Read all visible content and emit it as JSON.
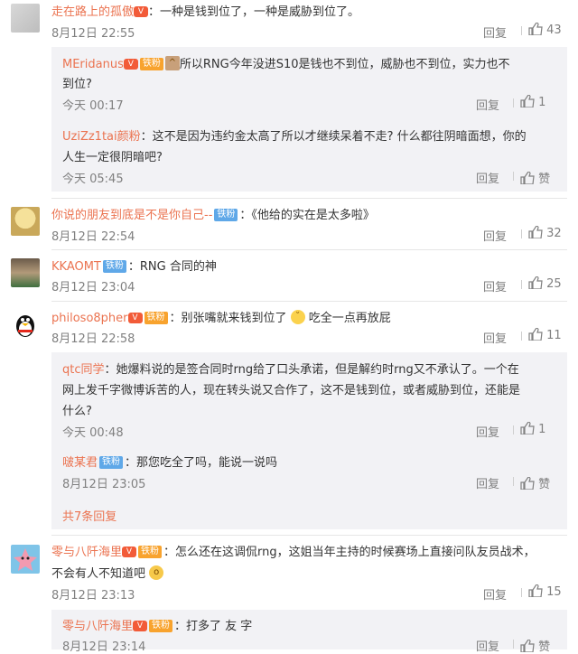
{
  "comments": [
    {
      "name": "走在路上的孤傲",
      "text": "：一种是钱到位了，一种是威胁到位了。",
      "time": "8月12日 22:55",
      "reply_label": "回复",
      "likes": "43",
      "replies": [
        {
          "name": "MEridanus",
          "text1": "所以RNG今年没进S10是钱也不到位，威胁也不到位，实力也不",
          "text2": "到位?",
          "time": "今天 00:17",
          "reply_label": "回复",
          "likes": "1"
        },
        {
          "name": "UziZz1tai颜粉",
          "text1": "：这不是因为违约金太高了所以才继续呆着不走? 什么都往阴暗面想，你的",
          "text2": "人生一定很阴暗吧?",
          "time": "今天 05:45",
          "reply_label": "回复",
          "likes": "赞"
        }
      ]
    },
    {
      "name": "你说的朋友到底是不是你自己--",
      "badge": "铁粉",
      "text": "：《他给的实在是太多啦》",
      "time": "8月12日 22:54",
      "reply_label": "回复",
      "likes": "32"
    },
    {
      "name": "KKAOMT",
      "badge": "铁粉",
      "text": "：RNG 合同的神",
      "time": "8月12日 23:04",
      "reply_label": "回复",
      "likes": "25"
    },
    {
      "name": "philoso8pher",
      "badge": "铁粉",
      "text": "：别张嘴就来钱到位了",
      "text_after": "吃全一点再放屁",
      "time": "8月12日 22:58",
      "reply_label": "回复",
      "likes": "11",
      "replies": [
        {
          "name": "qtc同学",
          "text1": "：她爆料说的是签合同时rng给了口头承诺，但是解约时rng又不承认了。一个在",
          "text2": "网上发千字微博诉苦的人，现在转头说又合作了，这不是钱到位，或者威胁到位，还能是",
          "text3": "什么?",
          "time": "今天 00:48",
          "reply_label": "回复",
          "likes": "1"
        },
        {
          "name": "啵某君",
          "badge": "铁粉",
          "text1": "：那您吃全了吗，能说一说吗",
          "time": "8月12日 23:05",
          "reply_label": "回复",
          "likes": "赞"
        }
      ],
      "more": "共7条回复"
    },
    {
      "name": "零与八阡海里",
      "badge": "铁粉",
      "text1": "：怎么还在这调侃rng，这姐当年主持的时候赛场上直接问队友员战术，",
      "text2": "不会有人不知道吧",
      "time": "8月12日 23:13",
      "reply_label": "回复",
      "likes": "15",
      "replies": [
        {
          "name": "零与八阡海里",
          "badge": "铁粉",
          "text1": "：打多了 友 字",
          "time": "8月12日 23:14",
          "reply_label": "回复",
          "likes": "赞"
        }
      ]
    }
  ],
  "colors": {
    "name": "#eb7350",
    "badge_blue": "#5fa8e8",
    "badge_orange": "#f8a32e",
    "reply_bg": "#f2f2f5"
  }
}
